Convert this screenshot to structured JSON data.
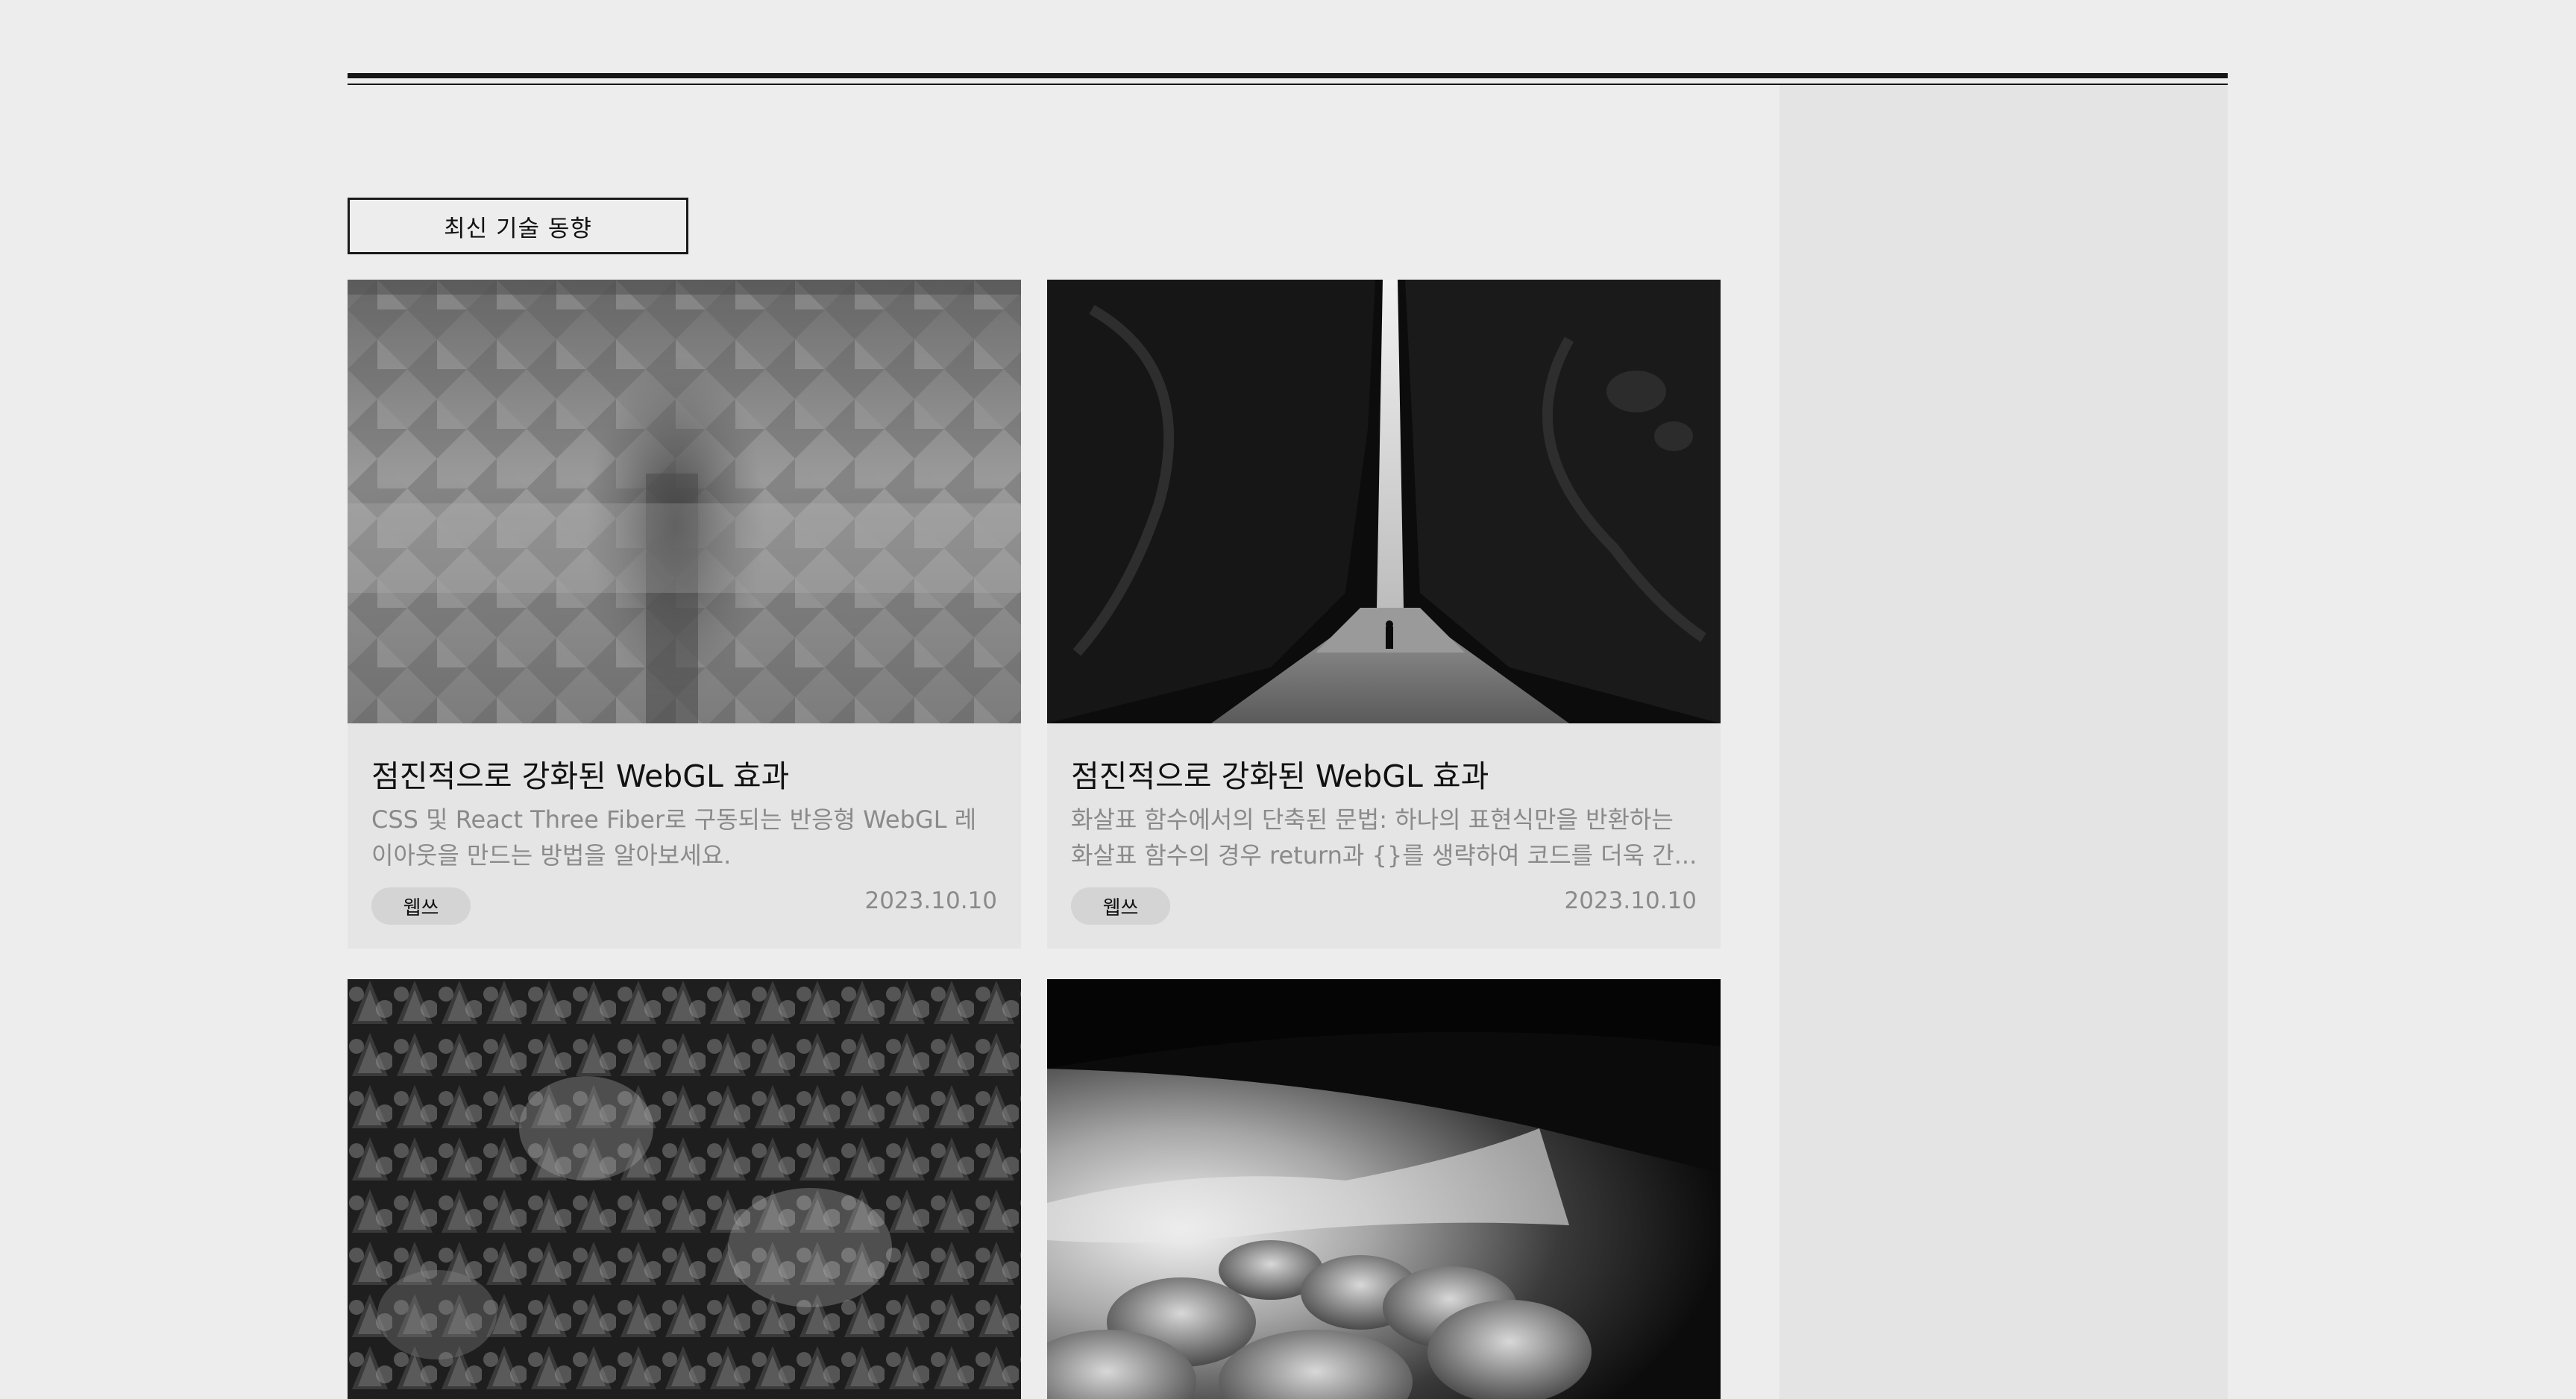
{
  "section": {
    "label": "최신 기술 동향"
  },
  "cards": [
    {
      "title": "점진적으로 강화된 WebGL 효과",
      "description": "CSS 및 React Three Fiber로 구동되는 반응형 WebGL 레이아웃을 만드는 방법을 알아보세요.",
      "tag": "웹쓰",
      "date": "2023.10.10",
      "image": "glass-pattern-photo"
    },
    {
      "title": "점진적으로 강화된 WebGL 효과",
      "description": "화살표 함수에서의 단축된 문법: 하나의 표현식만을 반환하는 화살표 함수의 경우 return과 {}를 생략하여 코드를 더욱 간...",
      "tag": "웹쓰",
      "date": "2023.10.10",
      "image": "canyon-walker-photo"
    },
    {
      "image": "forest-photo"
    },
    {
      "image": "clouds-photo"
    }
  ],
  "colors": {
    "background": "#ededed",
    "sidebar": "#e4e4e4",
    "card": "#e5e5e5",
    "rule": "#161616",
    "muted_text": "#8a8a8a",
    "tag_bg": "#d4d4d4"
  }
}
